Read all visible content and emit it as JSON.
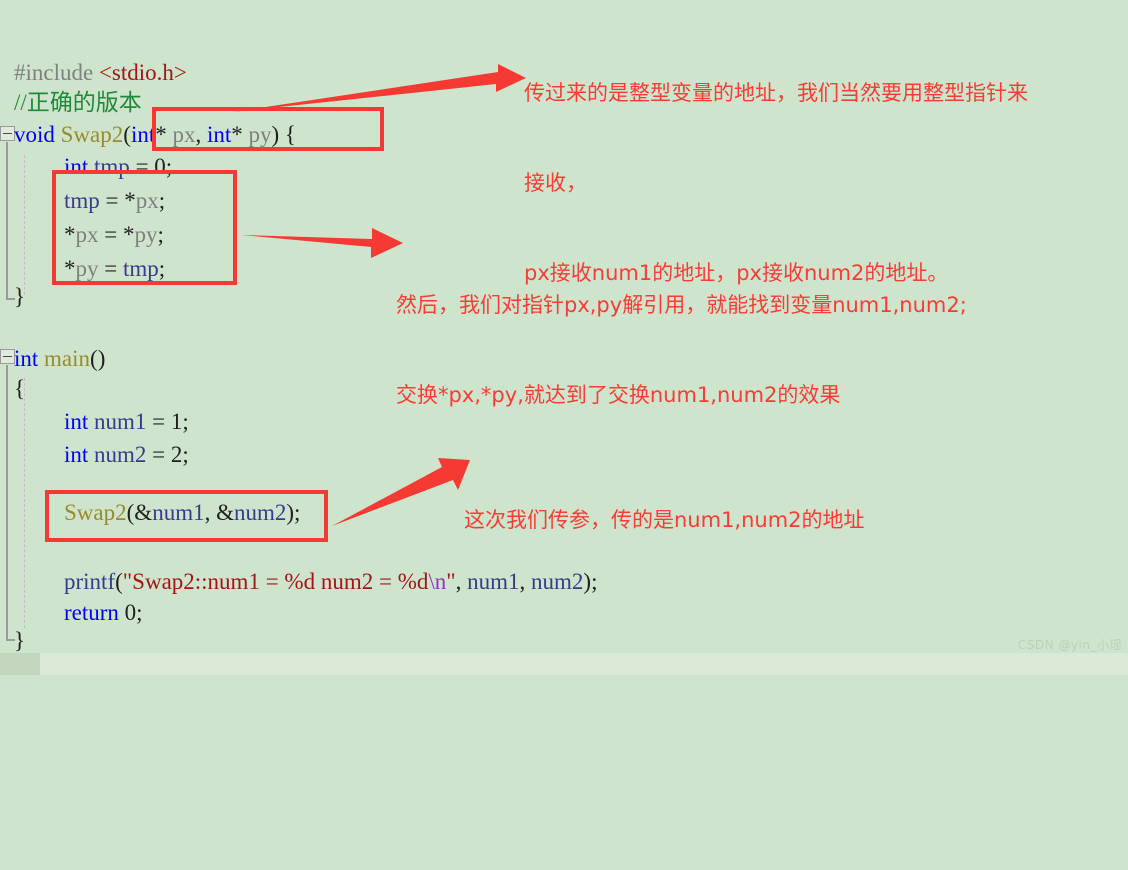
{
  "editor": {
    "background_color": "#cfe4cc",
    "lines": [
      {
        "id": "include",
        "indent": 0,
        "tokens": [
          {
            "t": "#include ",
            "c": "pp"
          },
          {
            "t": "<stdio.h>",
            "c": "str"
          }
        ]
      },
      {
        "id": "comment",
        "indent": 0,
        "tokens": [
          {
            "t": "//正确的版本",
            "c": "cmt"
          }
        ]
      },
      {
        "id": "swap2-sig",
        "indent": 0,
        "tokens": [
          {
            "t": "void ",
            "c": "k"
          },
          {
            "t": "Swap2",
            "c": "fn"
          },
          {
            "t": "(",
            "c": "pl"
          },
          {
            "t": "int",
            "c": "k"
          },
          {
            "t": "* ",
            "c": "pl"
          },
          {
            "t": "px",
            "c": "var"
          },
          {
            "t": ", ",
            "c": "pl"
          },
          {
            "t": "int",
            "c": "k"
          },
          {
            "t": "* ",
            "c": "pl"
          },
          {
            "t": "py",
            "c": "var"
          },
          {
            "t": ") {",
            "c": "pl"
          }
        ]
      },
      {
        "id": "tmp-decl",
        "indent": 2,
        "tokens": [
          {
            "t": "int ",
            "c": "k"
          },
          {
            "t": "tmp",
            "c": "idb"
          },
          {
            "t": " = ",
            "c": "pl"
          },
          {
            "t": "0",
            "c": "num"
          },
          {
            "t": ";",
            "c": "pl"
          }
        ]
      },
      {
        "id": "tmp-assign",
        "indent": 2,
        "tokens": [
          {
            "t": "tmp",
            "c": "idb"
          },
          {
            "t": " = *",
            "c": "pl"
          },
          {
            "t": "px",
            "c": "var"
          },
          {
            "t": ";",
            "c": "pl"
          }
        ]
      },
      {
        "id": "px-assign",
        "indent": 2,
        "tokens": [
          {
            "t": "*",
            "c": "pl"
          },
          {
            "t": "px",
            "c": "var"
          },
          {
            "t": " = *",
            "c": "pl"
          },
          {
            "t": "py",
            "c": "var"
          },
          {
            "t": ";",
            "c": "pl"
          }
        ]
      },
      {
        "id": "py-assign",
        "indent": 2,
        "tokens": [
          {
            "t": "*",
            "c": "pl"
          },
          {
            "t": "py",
            "c": "var"
          },
          {
            "t": " = ",
            "c": "pl"
          },
          {
            "t": "tmp",
            "c": "idb"
          },
          {
            "t": ";",
            "c": "pl"
          }
        ]
      },
      {
        "id": "swap2-end",
        "indent": 0,
        "tokens": [
          {
            "t": "}",
            "c": "pl"
          }
        ]
      },
      {
        "id": "main-sig",
        "indent": 0,
        "tokens": [
          {
            "t": "int ",
            "c": "k"
          },
          {
            "t": "main",
            "c": "fn"
          },
          {
            "t": "()",
            "c": "pl"
          }
        ]
      },
      {
        "id": "main-open",
        "indent": 0,
        "tokens": [
          {
            "t": "{",
            "c": "pl"
          }
        ]
      },
      {
        "id": "num1-decl",
        "indent": 2,
        "tokens": [
          {
            "t": "int ",
            "c": "k"
          },
          {
            "t": "num1",
            "c": "idb"
          },
          {
            "t": " = ",
            "c": "pl"
          },
          {
            "t": "1",
            "c": "num"
          },
          {
            "t": ";",
            "c": "pl"
          }
        ]
      },
      {
        "id": "num2-decl",
        "indent": 2,
        "tokens": [
          {
            "t": "int ",
            "c": "k"
          },
          {
            "t": "num2",
            "c": "idb"
          },
          {
            "t": " = ",
            "c": "pl"
          },
          {
            "t": "2",
            "c": "num"
          },
          {
            "t": ";",
            "c": "pl"
          }
        ]
      },
      {
        "id": "swap2-call",
        "indent": 2,
        "tokens": [
          {
            "t": "Swap2",
            "c": "fn"
          },
          {
            "t": "(&",
            "c": "pl"
          },
          {
            "t": "num1",
            "c": "idb"
          },
          {
            "t": ", &",
            "c": "pl"
          },
          {
            "t": "num2",
            "c": "idb"
          },
          {
            "t": ");",
            "c": "pl"
          }
        ]
      },
      {
        "id": "printf",
        "indent": 2,
        "tokens": [
          {
            "t": "printf",
            "c": "idb"
          },
          {
            "t": "(",
            "c": "pl"
          },
          {
            "t": "\"Swap2::num1 = %d num2 = %d",
            "c": "str"
          },
          {
            "t": "\\n",
            "c": "esc"
          },
          {
            "t": "\"",
            "c": "str"
          },
          {
            "t": ", ",
            "c": "pl"
          },
          {
            "t": "num1",
            "c": "idb"
          },
          {
            "t": ", ",
            "c": "pl"
          },
          {
            "t": "num2",
            "c": "idb"
          },
          {
            "t": ");",
            "c": "pl"
          }
        ]
      },
      {
        "id": "return",
        "indent": 2,
        "tokens": [
          {
            "t": "return ",
            "c": "k"
          },
          {
            "t": "0",
            "c": "num"
          },
          {
            "t": ";",
            "c": "pl"
          }
        ]
      },
      {
        "id": "main-end",
        "indent": 0,
        "tokens": [
          {
            "t": "}",
            "c": "pl"
          }
        ]
      }
    ]
  },
  "annotations": {
    "color": "#fb3b34",
    "top": {
      "line1": "传过来的是整型变量的地址，我们当然要用整型指针来",
      "line2": "接收，",
      "line3": "px接收num1的地址，px接收num2的地址。"
    },
    "middle": {
      "line1": "然后，我们对指针px,py解引用，就能找到变量num1,num2;",
      "line2": "交换*px,*py,就达到了交换num1,num2的效果"
    },
    "bottom": {
      "line1": "这次我们传参，传的是num1,num2的地址"
    }
  },
  "watermark": {
    "text": "CSDN @yin_小瑶"
  }
}
